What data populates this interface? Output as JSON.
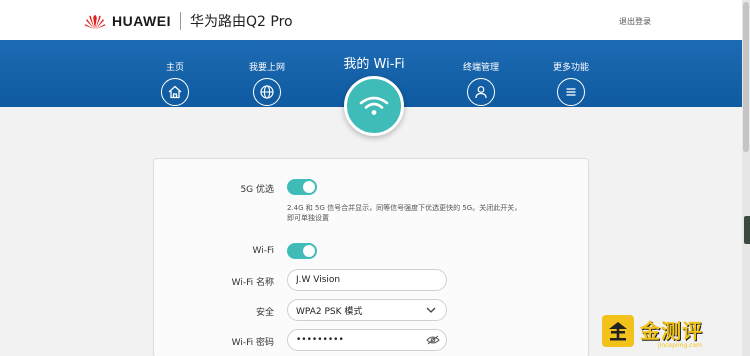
{
  "header": {
    "brand": "HUAWEI",
    "product": "华为路由Q2 Pro",
    "logout": "退出登录"
  },
  "nav": {
    "items": [
      {
        "label": "主页",
        "icon": "home-icon"
      },
      {
        "label": "我要上网",
        "icon": "globe-icon"
      },
      {
        "label": "终端管理",
        "icon": "user-icon"
      },
      {
        "label": "更多功能",
        "icon": "menu-icon"
      }
    ],
    "active": {
      "label": "我的 Wi-Fi",
      "icon": "wifi-icon"
    }
  },
  "settings": {
    "pref5g_label": "5G 优选",
    "pref5g_on": true,
    "pref5g_hint": "2.4G 和 5G 信号合并显示，同等信号强度下优选更快的 5G。关闭此开关，即可单独设置",
    "wifi_label": "Wi-Fi",
    "wifi_on": true,
    "name_label": "Wi-Fi 名称",
    "name_value": "J.W Vision",
    "security_label": "安全",
    "security_value": "WPA2 PSK 模式",
    "password_label": "Wi-Fi 密码",
    "password_value": "•••••••••"
  },
  "watermark": {
    "text": "金测评",
    "sub": "jincepimg.com"
  },
  "colors": {
    "nav_blue": "#1366ad",
    "accent_teal": "#3fbcb8",
    "brand_red": "#e0211f",
    "watermark_gold": "#f2c21a"
  }
}
